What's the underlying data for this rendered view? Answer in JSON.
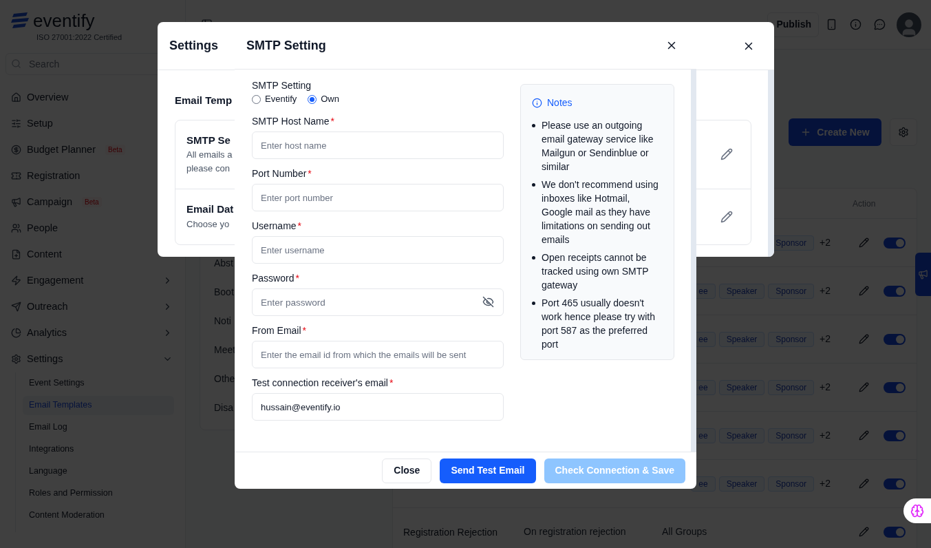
{
  "sidebar": {
    "logo": "eventify",
    "certification": "ISO 27001:2022 Certified",
    "search_placeholder": "Search",
    "items": [
      {
        "label": "Overview",
        "kind": "link"
      },
      {
        "label": "Setup",
        "kind": "link"
      },
      {
        "label": "Budget Planner",
        "kind": "link",
        "badge": "Beta"
      },
      {
        "label": "Registration",
        "kind": "link"
      },
      {
        "label": "Campaign",
        "kind": "link",
        "badge": "Beta"
      },
      {
        "label": "People",
        "kind": "link"
      },
      {
        "label": "Content",
        "kind": "link"
      },
      {
        "label": "Engagement",
        "kind": "group",
        "expanded": false
      },
      {
        "label": "Outreach",
        "kind": "group",
        "expanded": false
      },
      {
        "label": "Analytics",
        "kind": "group",
        "expanded": false
      },
      {
        "label": "Settings",
        "kind": "group",
        "expanded": true,
        "children": [
          {
            "label": "Event Settings",
            "selected": false
          },
          {
            "label": "Email Templates",
            "selected": true
          },
          {
            "label": "Email Log",
            "selected": false
          },
          {
            "label": "Integrations",
            "selected": false
          },
          {
            "label": "Language",
            "selected": false
          },
          {
            "label": "Roles and Permission",
            "selected": false
          },
          {
            "label": "Content Moderation",
            "selected": false
          }
        ]
      }
    ]
  },
  "header": {
    "publish_button": "Publish"
  },
  "main": {
    "create_button": "Create New",
    "template_list": [
      "Abst",
      "Boot",
      "Noti",
      "Meet",
      "Othe",
      "Disa"
    ],
    "table": {
      "action_header": "Action",
      "rows": [
        {
          "kind": "tags",
          "tags": [
            "Sponsor"
          ],
          "more": "+2",
          "enabled": true
        },
        {
          "kind": "tags",
          "tags": [
            "ee",
            "Speaker",
            "Sponsor"
          ],
          "more": "+2",
          "enabled": true
        },
        {
          "kind": "tags",
          "tags": [
            "ee",
            "Speaker",
            "Sponsor"
          ],
          "more": "+2",
          "enabled": true
        },
        {
          "kind": "tags",
          "tags": [
            "ee",
            "Speaker",
            "Sponsor"
          ],
          "more": "+2",
          "enabled": true
        },
        {
          "kind": "tags",
          "tags": [
            "ee",
            "Speaker",
            "Sponsor"
          ],
          "more": "+2",
          "enabled": true
        },
        {
          "kind": "tags",
          "tags": [
            "ee",
            "Speaker",
            "Sponsor"
          ],
          "more": "+2",
          "enabled": true
        },
        {
          "kind": "text",
          "name": "Registration Rejection",
          "trigger": "On registration rejection",
          "groups": "All Groups",
          "enabled": true
        }
      ]
    }
  },
  "settings_modal": {
    "title": "Settings",
    "section_title": "Email Temp",
    "cards": [
      {
        "title": "SMTP Se",
        "lines": [
          "All emails a",
          "please con"
        ]
      },
      {
        "title": "Email Dat",
        "lines": [
          "Choose yo"
        ]
      }
    ]
  },
  "smtp_modal": {
    "title": "SMTP Setting",
    "mode_label": "SMTP Setting",
    "modes": [
      {
        "label": "Eventify",
        "selected": false
      },
      {
        "label": "Own",
        "selected": true
      }
    ],
    "fields": [
      {
        "label": "SMTP Host Name",
        "required_mark": "*",
        "kind": "text",
        "placeholder": "Enter host name"
      },
      {
        "label": "Port Number",
        "required_mark": "*",
        "kind": "text",
        "placeholder": "Enter port number"
      },
      {
        "label": "Username",
        "required_mark": "*",
        "kind": "text",
        "placeholder": "Enter username"
      },
      {
        "label": "Password",
        "required_mark": "*",
        "kind": "password",
        "placeholder": "Enter password"
      },
      {
        "label": "From Email",
        "required_mark": "*",
        "kind": "text",
        "placeholder": "Enter the email id from which the emails will be sent"
      },
      {
        "label": "Test connection receiver's email",
        "required_mark": "*",
        "kind": "text",
        "value": "hussain@eventify.io"
      }
    ],
    "notes": {
      "title": "Notes",
      "items": [
        "Please use an outgoing email gateway service like Mailgun or Sendinblue or similar",
        "We don't recommend using inboxes like Hotmail, Google mail as they have limitations on sending out emails",
        "Open receipts cannot be tracked using own SMTP gateway",
        "Port 465 usually doesn't work hence please try with port 587 as the preferred port"
      ]
    },
    "buttons": [
      {
        "label": "Close",
        "kind": "secondary",
        "disabled": false
      },
      {
        "label": "Send Test Email",
        "kind": "primary",
        "disabled": false
      },
      {
        "label": "Check Connection & Save",
        "kind": "primary",
        "disabled": true
      }
    ]
  }
}
